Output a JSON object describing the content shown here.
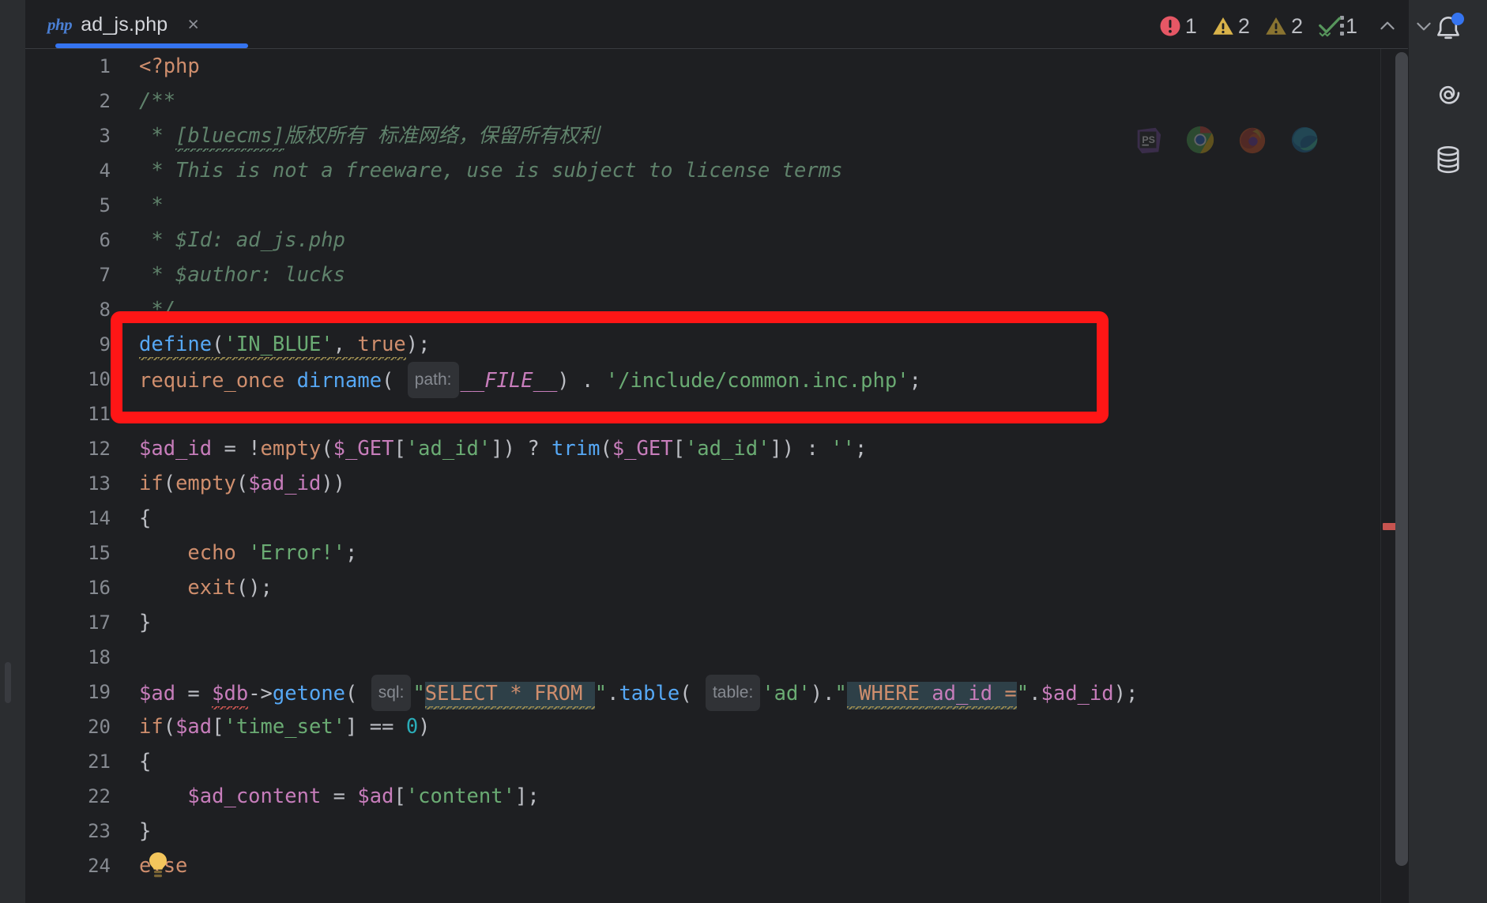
{
  "window": {
    "background": "#1E1F22",
    "panel": "#2B2D30"
  },
  "tab": {
    "file_type_label": "php",
    "title": "ad_js.php",
    "close_label": "×",
    "active": true,
    "accent_color": "#3574F0"
  },
  "tab_menu": {
    "name": "more-options"
  },
  "inspection_widget": {
    "items": [
      {
        "icon": "error-icon",
        "count": "1",
        "color": "#E55765"
      },
      {
        "icon": "warning-icon",
        "count": "2",
        "color": "#D9B34A"
      },
      {
        "icon": "weak-warning-icon",
        "count": "2",
        "color": "#8A7431"
      },
      {
        "icon": "ok-check-icon",
        "count": "1",
        "color": "#57965C"
      }
    ],
    "prev_label": "⌃",
    "next_label": "⌄"
  },
  "browser_run_icons": [
    {
      "name": "phpstorm-icon",
      "label": "PS"
    },
    {
      "name": "chrome-icon",
      "label": "Chrome"
    },
    {
      "name": "firefox-icon",
      "label": "Firefox"
    },
    {
      "name": "edge-icon",
      "label": "Edge"
    }
  ],
  "right_rail": [
    {
      "name": "notifications-icon",
      "label": "Notifications",
      "badge": true
    },
    {
      "name": "ai-assistant-icon",
      "label": "AI Assistant",
      "badge": false
    },
    {
      "name": "database-icon",
      "label": "Database",
      "badge": false
    }
  ],
  "annotation": {
    "type": "red-rectangle-highlight",
    "color": "#FF1616",
    "covers_lines": "9-11"
  },
  "editor": {
    "language": "PHP",
    "first_visible_line": 1,
    "last_visible_line": 25,
    "line_numbers": [
      "1",
      "2",
      "3",
      "4",
      "5",
      "6",
      "7",
      "8",
      "9",
      "10",
      "11",
      "12",
      "13",
      "14",
      "15",
      "16",
      "17",
      "18",
      "19",
      "20",
      "21",
      "22",
      "23",
      "24"
    ],
    "lines": [
      {
        "n": "1",
        "text": "<?php"
      },
      {
        "n": "2",
        "text": "/**"
      },
      {
        "n": "3",
        "text": " * [bluecms]版权所有 标准网络，保留所有权利"
      },
      {
        "n": "4",
        "text": " * This is not a freeware, use is subject to license terms"
      },
      {
        "n": "5",
        "text": " *"
      },
      {
        "n": "6",
        "text": " * $Id: ad_js.php"
      },
      {
        "n": "7",
        "text": " * $author: lucks"
      },
      {
        "n": "8",
        "text": " */"
      },
      {
        "n": "9",
        "text": "define('IN_BLUE', true);"
      },
      {
        "n": "10",
        "text": "require_once dirname( path: __FILE__) . '/include/common.inc.php';"
      },
      {
        "n": "11",
        "text": ""
      },
      {
        "n": "12",
        "text": "$ad_id = !empty($_GET['ad_id']) ? trim($_GET['ad_id']) : '';"
      },
      {
        "n": "13",
        "text": "if(empty($ad_id))"
      },
      {
        "n": "14",
        "text": "{"
      },
      {
        "n": "15",
        "text": "    echo 'Error!';"
      },
      {
        "n": "16",
        "text": "    exit();"
      },
      {
        "n": "17",
        "text": "}"
      },
      {
        "n": "18",
        "text": ""
      },
      {
        "n": "19",
        "text": "$ad = $db->getone( sql: \"SELECT * FROM \".table( table: 'ad').\" WHERE ad_id =\".$ad_id);"
      },
      {
        "n": "20",
        "text": "if($ad['time_set'] == 0)"
      },
      {
        "n": "21",
        "text": "{"
      },
      {
        "n": "22",
        "text": "    $ad_content = $ad['content'];"
      },
      {
        "n": "23",
        "text": "}"
      },
      {
        "n": "24",
        "text": "else"
      }
    ],
    "inlay_hints": [
      {
        "line": "10",
        "text": "path:"
      },
      {
        "line": "19",
        "text": "sql:"
      },
      {
        "line": "19",
        "text": "table:"
      }
    ],
    "tokens": {
      "l1_php_open": "<?php",
      "l2_comment": "/**",
      "l3_comment_star": " * ",
      "l3_bluecms": "[bluecms]",
      "l3_cn": "版权所有 标准网络，保留所有权利",
      "l4_comment": " * This is not a freeware, use is subject to license terms",
      "l5_comment": " *",
      "l6_comment": " * $Id: ad_js.php",
      "l7_comment": " * $author: lucks",
      "l8_comment": " */",
      "l9_define": "define",
      "l9_open": "(",
      "l9_str": "'IN_BLUE'",
      "l9_comma": ", ",
      "l9_true": "true",
      "l9_close": ");",
      "l10_req": "require_once",
      "l10_dirname": "dirname",
      "l10_open": "( ",
      "l10_hint": "path:",
      "l10_file": "__FILE__",
      "l10_mid": ") . ",
      "l10_path": "'/include/common.inc.php'",
      "l10_semi": ";",
      "l12_var": "$ad_id",
      "l12_eq": " = ",
      "l12_not": "!",
      "l12_empty": "empty",
      "l12_p1": "(",
      "l12_get": "$_GET",
      "l12_b1": "[",
      "l12_key": "'ad_id'",
      "l12_b2": "])",
      "l12_q": " ? ",
      "l12_trim": "trim",
      "l12_p2": "(",
      "l12_get2": "$_GET",
      "l12_b3": "[",
      "l12_key2": "'ad_id'",
      "l12_b4": "])",
      "l12_colon": " : ",
      "l12_empty_str": "''",
      "l12_semi": ";",
      "l13_if": "if",
      "l13_p1": "(",
      "l13_empty": "empty",
      "l13_p2": "(",
      "l13_var": "$ad_id",
      "l13_p3": "))",
      "l14_brace": "{",
      "l15_echo": "echo",
      "l15_str": "'Error!'",
      "l15_semi": ";",
      "l16_exit": "exit",
      "l16_p": "();",
      "l17_brace": "}",
      "l19_ad": "$ad",
      "l19_eq": " = ",
      "l19_db": "$db",
      "l19_arrow": "->",
      "l19_getone": "getone",
      "l19_open": "( ",
      "l19_hint_sql": "sql:",
      "l19_q1": "\"",
      "l19_sel": "SELECT * FROM ",
      "l19_q2": "\"",
      "l19_dot1": ".",
      "l19_table": "table",
      "l19_open2": "( ",
      "l19_hint_tbl": "table:",
      "l19_ad_str": "'ad'",
      "l19_close2": ")",
      "l19_dot2": ".",
      "l19_q3": "\"",
      "l19_where": " WHERE ",
      "l19_col": "ad_id",
      "l19_op": " =",
      "l19_q4": "\"",
      "l19_dot3": ".",
      "l19_adid": "$ad_id",
      "l19_close": ");",
      "l20_if": "if",
      "l20_p1": "(",
      "l20_ad": "$ad",
      "l20_b1": "[",
      "l20_key": "'time_set'",
      "l20_b2": "]",
      "l20_eq": " == ",
      "l20_zero": "0",
      "l20_p2": ")",
      "l21_brace": "{",
      "l22_content": "$ad_content",
      "l22_eq": " = ",
      "l22_ad": "$ad",
      "l22_b1": "[",
      "l22_key": "'content'",
      "l22_b2": "];",
      "l23_brace": "}",
      "l24_else": "else"
    },
    "markers": {
      "typo_bluecms": "green-wavy-underline",
      "weak_warning_define": "yellow-wavy-underline",
      "sql_injection_highlight": "#2E4048",
      "error_db": "red-wavy-underline",
      "intention_bulb": "lightbulb-icon"
    }
  },
  "scrollbar": {
    "name": "editor-vertical-scrollbar",
    "error_marker_color": "#C75450"
  }
}
